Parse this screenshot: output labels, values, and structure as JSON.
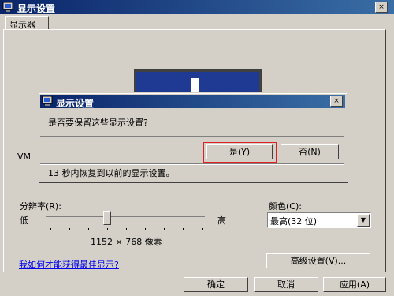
{
  "window": {
    "title": "显示设置",
    "close": "×"
  },
  "tab": {
    "label": "显示器"
  },
  "monitor": {
    "number": "1",
    "name": "VM"
  },
  "resolution": {
    "label": "分辨率(R):",
    "low": "低",
    "high": "高",
    "value_text": "1152 × 768 像素",
    "slider_level": 0.38
  },
  "color": {
    "label": "颜色(C):",
    "selected": "最高(32 位)",
    "dropdown_arrow": "▼"
  },
  "advanced_button": "高级设置(V)...",
  "help_link": "我如何才能获得最佳显示?",
  "footer_buttons": {
    "ok": "确定",
    "cancel": "取消",
    "apply": "应用(A)"
  },
  "dialog": {
    "title": "显示设置",
    "close": "×",
    "question": "是否要保留这些显示设置?",
    "yes": "是(Y)",
    "no": "否(N)",
    "countdown": "13 秒内恢复到以前的显示设置。"
  },
  "icons": {
    "window_icon": "display-settings-icon",
    "dialog_icon": "display-settings-icon"
  },
  "colors": {
    "titlebar": "#0a246a",
    "face": "#d4d0c8",
    "monitor_screen": "#1f3a93",
    "highlight": "#e02020"
  }
}
